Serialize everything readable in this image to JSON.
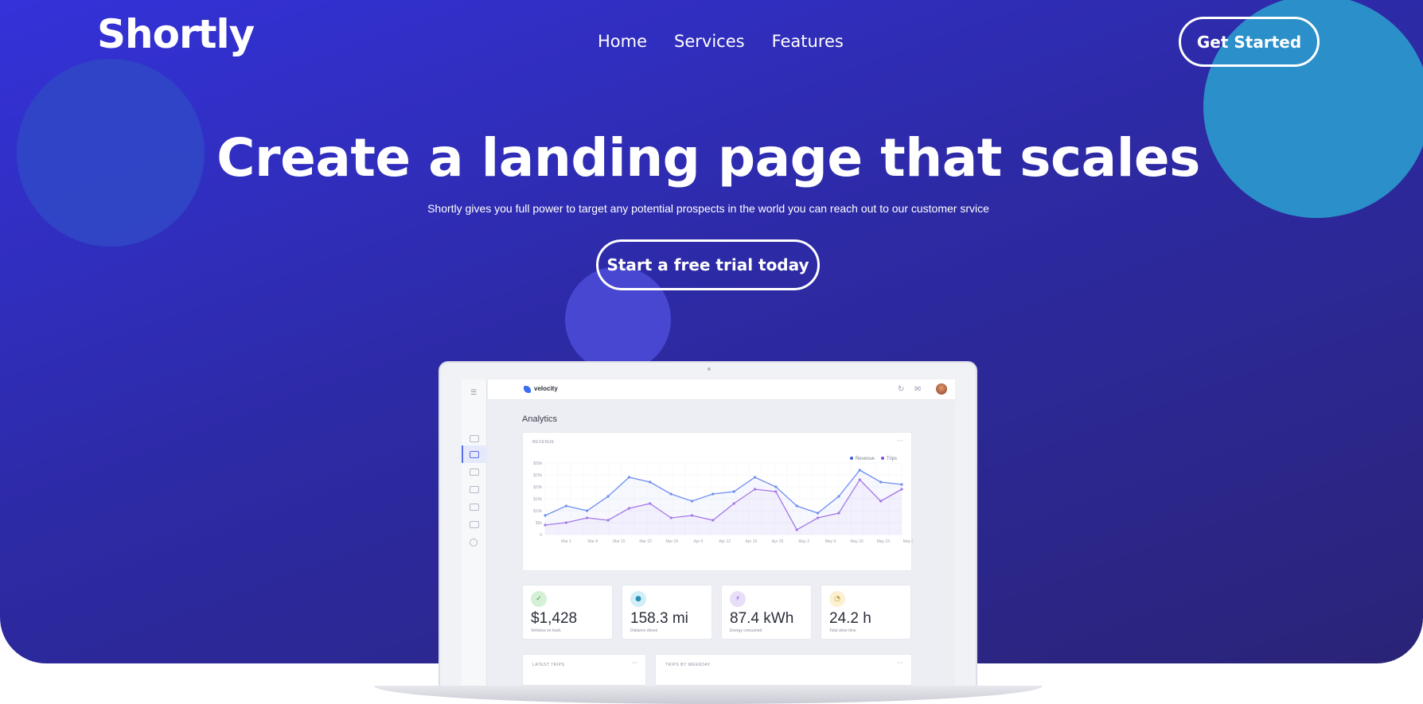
{
  "header": {
    "logo": "Shortly",
    "nav": [
      "Home",
      "Services",
      "Features"
    ],
    "cta_label": "Get Started"
  },
  "hero": {
    "headline": "Create a landing page that scales",
    "subline": "Shortly gives you full power to target any potential prospects in the world you can reach out to our customer srvice",
    "cta_label": "Start a free trial today"
  },
  "dashboard": {
    "brand": "velocity",
    "page_title": "Analytics",
    "revenue_card_label": "REVENUE",
    "legend": [
      {
        "name": "Revenue",
        "color": "#3b5bdb"
      },
      {
        "name": "Trips",
        "color": "#7c4ddb"
      }
    ],
    "chart_data": {
      "type": "line",
      "title": "REVENUE",
      "categories": [
        "Mar 1",
        "Mar 8",
        "Mar 15",
        "Mar 22",
        "Mar 29",
        "Apr 5",
        "Apr 12",
        "Apr 19",
        "Apr 26",
        "May 2",
        "May 9",
        "May 16",
        "May 23",
        "May 30"
      ],
      "y_ticks": [
        "0",
        "$5k",
        "$10k",
        "$15k",
        "$20k",
        "$25k",
        "$30k"
      ],
      "ylim": [
        0,
        30
      ],
      "series": [
        {
          "name": "Revenue",
          "color": "#6f8df0",
          "x": [
            0,
            0.7,
            1.5,
            2.3,
            3.0,
            3.6,
            4.4,
            5.0,
            5.6,
            6.2,
            6.9,
            7.5,
            8.0,
            8.6,
            9.2,
            9.8,
            10.4,
            11.0,
            11.6,
            12.1,
            12.8,
            13.4
          ],
          "values": [
            8,
            12,
            10,
            16,
            24,
            22,
            17,
            14,
            17,
            18,
            24,
            20,
            12,
            9,
            16,
            27,
            22,
            21
          ]
        },
        {
          "name": "Trips",
          "color": "#a578e6",
          "x": [
            0,
            0.7,
            1.5,
            2.3,
            3.0,
            3.6,
            4.4,
            5.0,
            5.6,
            6.2,
            6.9,
            7.5,
            8.0,
            8.6,
            9.2,
            9.8,
            10.4,
            11.0
          ],
          "values": [
            4,
            5,
            7,
            6,
            11,
            13,
            7,
            8,
            6,
            13,
            19,
            18,
            2,
            7,
            9,
            23,
            14,
            19
          ]
        }
      ]
    },
    "stats": [
      {
        "value": "$1,428",
        "label": "Vehicles on track",
        "icon": "check-icon",
        "bg": "#d4f0d6",
        "fg": "#3a9a48"
      },
      {
        "value": "158.3 mi",
        "label": "Distance driven",
        "icon": "pin-icon",
        "bg": "#d2eef6",
        "fg": "#2b8fb8"
      },
      {
        "value": "87.4 kWh",
        "label": "Energy consumed",
        "icon": "bolt-icon",
        "bg": "#e9def8",
        "fg": "#7c4ddb"
      },
      {
        "value": "24.2 h",
        "label": "Total drive time",
        "icon": "clock-icon",
        "bg": "#fbf0d2",
        "fg": "#c29a25"
      }
    ],
    "latest_trips_label": "LATEST TRIPS",
    "trips_by_weekday_label": "TRIPS BY WEEKDAY"
  }
}
